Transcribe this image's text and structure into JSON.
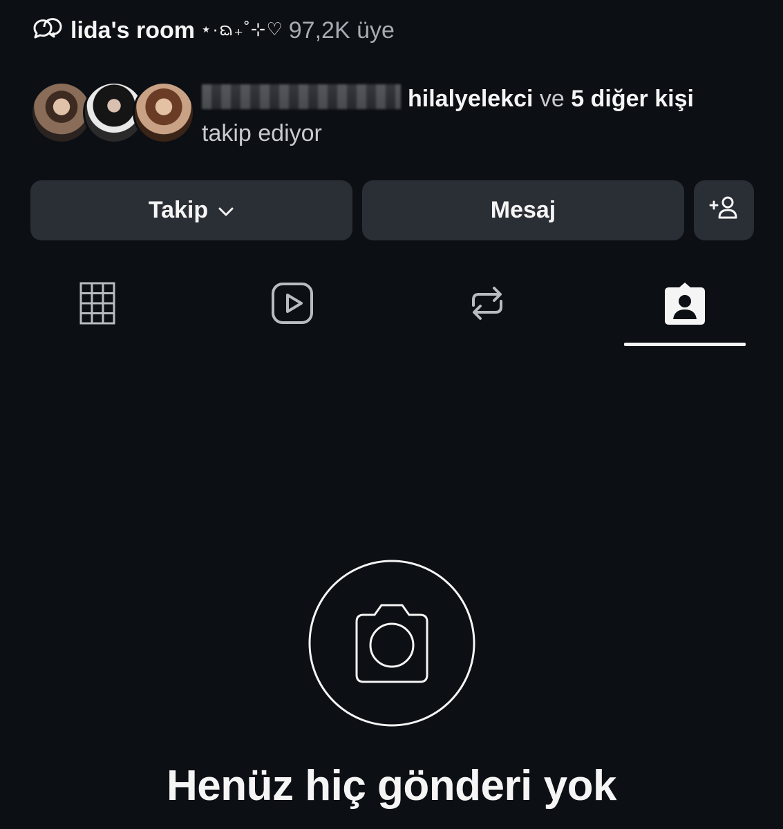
{
  "channel": {
    "icon": "channel-chat-icon",
    "name": "lida's room",
    "decoration": "⋆·ᨳ₊˚⊹♡",
    "members": "97,2K üye"
  },
  "followed_by": {
    "avatars": [
      "avatar-1",
      "avatar-2",
      "avatar-3"
    ],
    "known_user": "hilalyelekci",
    "conjunction": "ve",
    "others": "5 diğer kişi",
    "suffix": "takip ediyor"
  },
  "actions": {
    "follow_label": "Takip",
    "message_label": "Mesaj",
    "add_person_icon": "add-person-icon"
  },
  "tabs": [
    {
      "icon": "grid-icon",
      "active": false
    },
    {
      "icon": "reels-icon",
      "active": false
    },
    {
      "icon": "repost-icon",
      "active": false
    },
    {
      "icon": "tagged-icon",
      "active": true
    }
  ],
  "empty_state": {
    "icon": "camera-icon",
    "title": "Henüz hiç gönderi yok"
  },
  "colors": {
    "background": "#0c0f14",
    "button": "#2a2e35",
    "text": "#f5f5f5",
    "muted": "#a8abb1"
  }
}
